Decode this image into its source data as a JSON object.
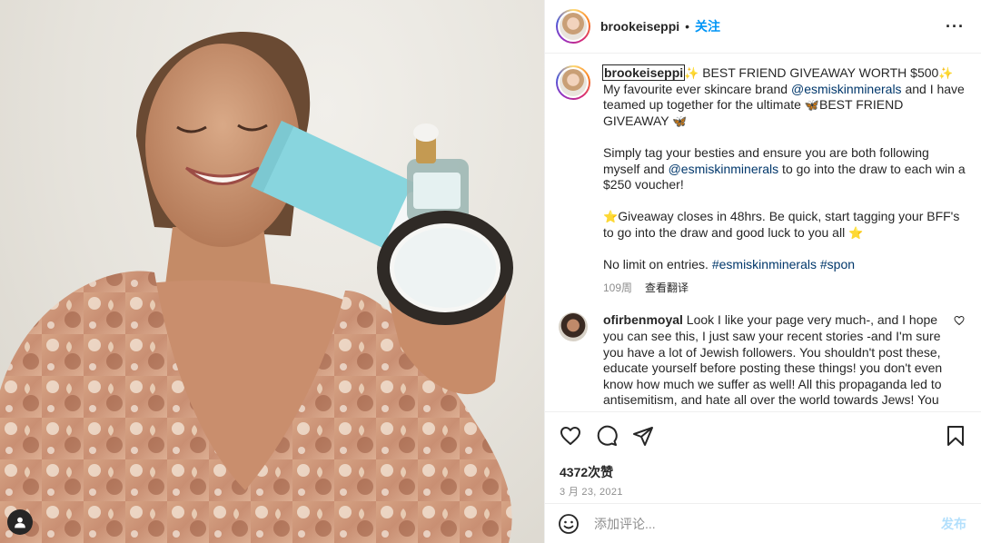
{
  "post": {
    "author": "brookeiseppi",
    "separator": "•",
    "follow_label": "关注",
    "more_label": "···"
  },
  "caption": {
    "username": "brookeiseppi",
    "line1_text": " BEST FRIEND GIVEAWAY WORTH $500",
    "line1_tail": " My favourite ever skincare brand ",
    "mention1": "@esmiskinminerals",
    "line2_text": " and I have teamed up together for the ultimate ",
    "line2_tail": "BEST FRIEND GIVEAWAY ",
    "para2_a": "Simply tag your besties and ensure you are both following myself and ",
    "mention2": "@esmiskinminerals",
    "para2_b": " to go into the draw to each win a $250 voucher!",
    "para3": "Giveaway closes in 48hrs. Be quick, start tagging your BFF's to go into the draw and good luck to you all ",
    "para4_text": "No limit on entries. ",
    "hashtag1": "#esmiskinminerals",
    "hashtag2": "#spon",
    "age": "109周",
    "translate_label": "查看翻译"
  },
  "emoji": {
    "sparkles": "✨",
    "butterfly": "🦋",
    "star": "⭐"
  },
  "comment": {
    "username": "ofirbenmoyal",
    "text": " Look I like your page very much-, and I hope you can see this, I just saw your recent stories -and I'm sure you have a lot of Jewish followers. You shouldn't post these, educate yourself before posting these things! you don't even know how much we suffer as well! All this propaganda led to antisemitism, and hate all over the world towards Jews! You"
  },
  "stats": {
    "likes": "4372次赞",
    "date": "3 月 23, 2021"
  },
  "composer": {
    "placeholder": "添加评论...",
    "post_label": "发布"
  },
  "icons": [
    "heart-icon",
    "comment-icon",
    "share-icon",
    "bookmark-icon",
    "emoji-icon",
    "user-tag-icon",
    "more-icon"
  ],
  "colors": {
    "accent": "#0095f6",
    "link": "#00376b",
    "muted": "#8e8e8e",
    "post_disabled": "#b2dffc"
  }
}
